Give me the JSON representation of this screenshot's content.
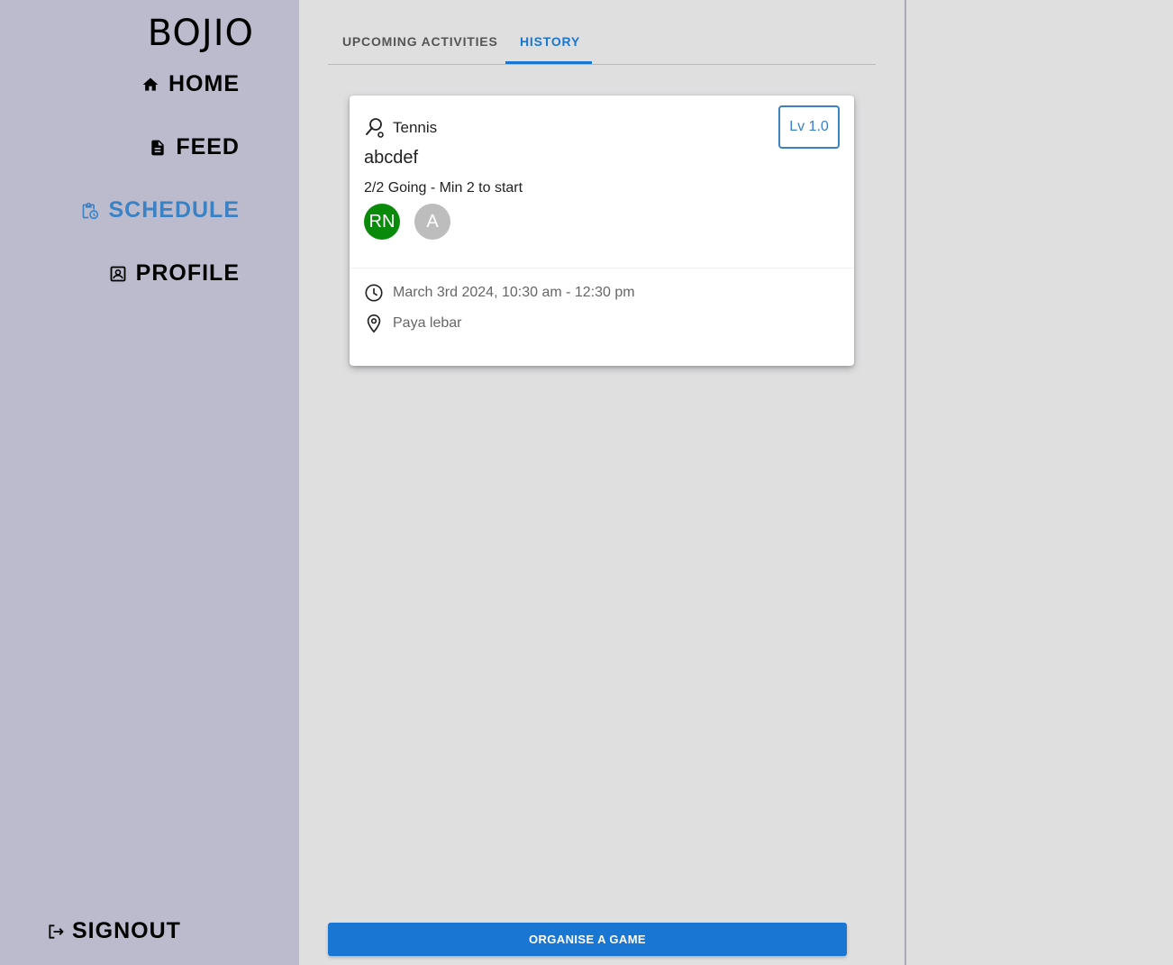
{
  "sidebar": {
    "brand": "BOJIO",
    "items": [
      {
        "label": "HOME",
        "icon": "home-icon"
      },
      {
        "label": "FEED",
        "icon": "article-icon"
      },
      {
        "label": "SCHEDULE",
        "icon": "schedule-clipboard-icon",
        "active": true
      },
      {
        "label": "PROFILE",
        "icon": "profile-icon"
      }
    ],
    "signout": {
      "label": "SIGNOUT",
      "icon": "logout-icon"
    }
  },
  "tabs": [
    {
      "label": "UPCOMING ACTIVITIES",
      "active": false
    },
    {
      "label": "HISTORY",
      "active": true
    }
  ],
  "card": {
    "sport": "Tennis",
    "sport_icon": "racket-icon",
    "level": "Lv 1.0",
    "title": "abcdef",
    "going": "2/2 Going - Min 2 to start",
    "avatars": [
      {
        "initials": "RN",
        "color": "#0a8a0a"
      },
      {
        "initials": "A",
        "color": "#bdbdbd"
      }
    ],
    "datetime": "March 3rd 2024, 10:30 am - 12:30 pm",
    "location": "Paya lebar"
  },
  "organise_button": "ORGANISE A GAME",
  "colors": {
    "sidebar_bg": "#bbbbcd",
    "main_bg": "#dfdfe0",
    "accent": "#1976d2",
    "active_nav": "#3b82c4"
  }
}
